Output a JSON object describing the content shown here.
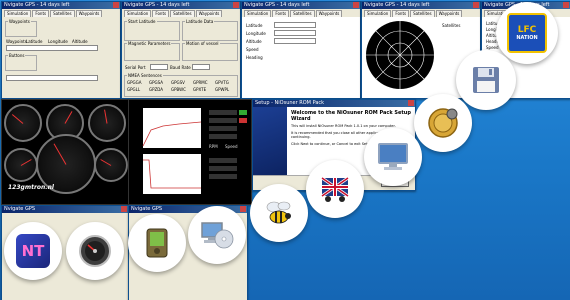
{
  "screens": {
    "window_title": "Nvigate GPS - 14 days left",
    "tabs_a": [
      "Simulation",
      "Fonts",
      "Satellites",
      "Waypoints"
    ],
    "tabs_b": [
      "Simulation",
      "Fonts",
      "Satellites",
      "Waypoints"
    ],
    "tabs_c": [
      "Simulation",
      "Fonts",
      "Satellites",
      "Waypoints"
    ],
    "tabs_d": [
      "Simulation",
      "Fonts",
      "Satellites",
      "Waypoints"
    ],
    "tabs_e": [
      "Simulation",
      "Fonts",
      "Satellites",
      "Waypoints"
    ],
    "panel_a": {
      "group1": "Waypoints",
      "group2": "Buttons",
      "labels": [
        "Waypoints",
        "Latitude",
        "Longitude",
        "Altitude"
      ]
    },
    "panel_b": {
      "group_start": "Start Latitude",
      "group_magnetic": "Magnetic Parameters",
      "group_motion": "Motion of vessel",
      "group_latitude": "Latitude Data",
      "nmea_title": "NMEA Sentences",
      "nmea_items": [
        "GPGGA",
        "GPGSA",
        "GPGSV",
        "GPRMC",
        "GPVTG",
        "GPGLL",
        "GPZDA",
        "GPBWC",
        "GPXTE",
        "GPWPL"
      ],
      "bottom_fields": [
        "Serial Port",
        "Baud Rate",
        "COM1",
        "4800"
      ]
    },
    "panel_c": {
      "labels": [
        "Latitude",
        "Longitude",
        "Altitude",
        "Speed",
        "Heading"
      ]
    },
    "panel_d": {
      "label": "Satellites"
    },
    "panel_e": {
      "labels": [
        "Latitude",
        "Longitude",
        "Altitude",
        "Heading",
        "Speed",
        "Date",
        "Time"
      ]
    }
  },
  "dashboard": {
    "brand": "123gmtron.nl",
    "chart_panel_labels": [
      "RPM",
      "Speed",
      "Boost",
      "Temp",
      "Oil"
    ]
  },
  "installer": {
    "window_title": "Setup - NiOsuner ROM Pack",
    "heading": "Welcome to the NiOsuner ROM Pack Setup Wizard",
    "body_1": "This will install NiOsuner ROM Pack 1.0.1 on your computer.",
    "body_2": "It is recommended that you close all other applications before continuing.",
    "body_3": "Click Next to continue, or Cancel to exit Setup.",
    "button": "Next"
  },
  "lower_windows": {
    "left_title": "Nvigate GPS",
    "right_title": "Nvigate GPS"
  },
  "icons": [
    {
      "name": "lfc-nation-icon",
      "label_1": "LFC",
      "label_2": "NATION"
    },
    {
      "name": "floppy-disk-icon"
    },
    {
      "name": "gold-coin-gear-icon"
    },
    {
      "name": "monitor-icon"
    },
    {
      "name": "truck-flag-icon"
    },
    {
      "name": "bee-icon"
    },
    {
      "name": "computer-cd-icon"
    },
    {
      "name": "pda-icon"
    },
    {
      "name": "speedometer-icon"
    },
    {
      "name": "nt-logo-icon",
      "label": "NT"
    }
  ],
  "colors": {
    "background": "#1a78c8",
    "dashboard": "#000000",
    "installer_accent": "#1c3f94"
  }
}
